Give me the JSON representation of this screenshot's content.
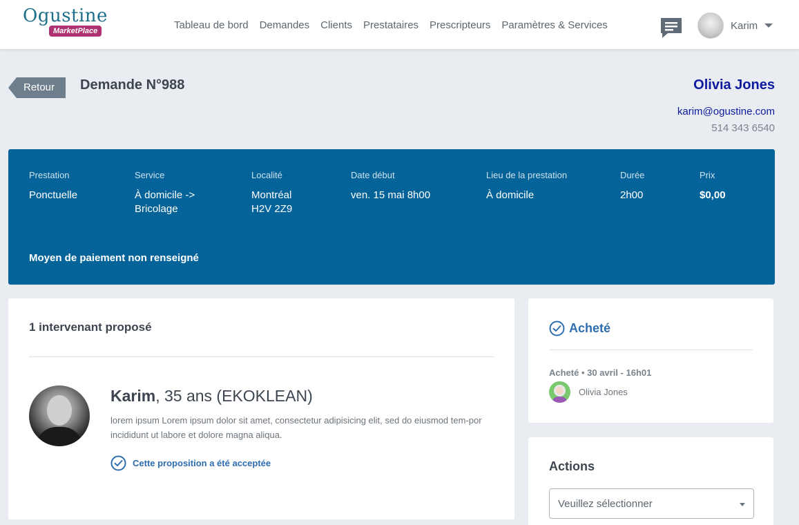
{
  "brand": {
    "name": "Ogustine",
    "badge": "MarketPlace"
  },
  "nav": {
    "items": [
      "Tableau de bord",
      "Demandes",
      "Clients",
      "Prestataires",
      "Prescripteurs",
      "Paramètres & Services"
    ]
  },
  "user": {
    "name": "Karim"
  },
  "page": {
    "back_label": "Retour",
    "title": "Demande N°988"
  },
  "client": {
    "name": "Olivia Jones",
    "email": "karim@ogustine.com",
    "phone": "514 343 6540"
  },
  "details": {
    "prestation": {
      "label": "Prestation",
      "value": "Ponctuelle"
    },
    "service": {
      "label": "Service",
      "value_1": "À domicile ->",
      "value_2": "Bricolage"
    },
    "localite": {
      "label": "Localité",
      "value_1": "Montréal",
      "value_2": "H2V 2Z9"
    },
    "date_debut": {
      "label": "Date début",
      "value": "ven. 15 mai 8h00"
    },
    "lieu": {
      "label": "Lieu de la prestation",
      "value": "À domicile"
    },
    "duree": {
      "label": "Durée",
      "value": "2h00"
    },
    "prix": {
      "label": "Prix",
      "value": "$0,00"
    },
    "payment": "Moyen de paiement non renseigné"
  },
  "proposals": {
    "title": "1 intervenant proposé",
    "person": {
      "name": "Karim",
      "details": ", 35 ans (EKOKLEAN)",
      "description": "lorem ipsum Lorem ipsum dolor sit amet, consectetur adipisicing elit, sed do eiusmod tem-por incididunt ut labore et dolore magna aliqua.",
      "accepted": "Cette proposition a été acceptée"
    }
  },
  "status": {
    "title": "Acheté",
    "meta": "Acheté • 30 avril - 16h01",
    "buyer": "Olivia Jones"
  },
  "actions": {
    "title": "Actions",
    "select_value": "Veuillez sélectionner"
  },
  "colors": {
    "panel": "#046399",
    "link": "#0d1a9e",
    "accent": "#2d6db0",
    "badge": "#b0316f"
  }
}
